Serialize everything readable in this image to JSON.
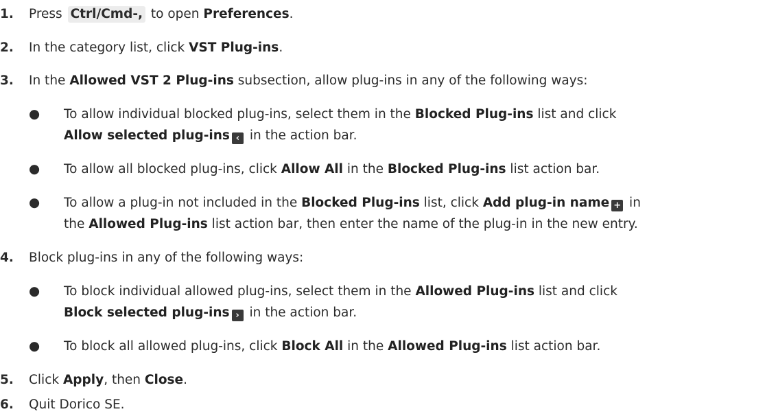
{
  "steps": [
    {
      "number": "1.",
      "parts": {
        "a": "Press ",
        "key": "Ctrl/Cmd-,",
        "b": " to open ",
        "c": "Preferences",
        "d": "."
      }
    },
    {
      "number": "2.",
      "parts": {
        "a": "In the category list, click ",
        "b": "VST Plug-ins",
        "c": "."
      }
    },
    {
      "number": "3.",
      "parts": {
        "a": "In the ",
        "b": "Allowed VST 2 Plug-ins",
        "c": " subsection, allow plug-ins in any of the following ways:"
      },
      "bullets": [
        {
          "line1": {
            "a": "To allow individual blocked plug-ins, select them in the ",
            "b": "Blocked Plug-ins",
            "c": " list and click"
          },
          "line2": {
            "a": "Allow selected plug-ins",
            "icon": "‹",
            "b": " in the action bar."
          }
        },
        {
          "line1": {
            "a": "To allow all blocked plug-ins, click ",
            "b": "Allow All",
            "c": " in the ",
            "d": "Blocked Plug-ins",
            "e": " list action bar."
          }
        },
        {
          "line1": {
            "a": "To allow a plug-in not included in the ",
            "b": "Blocked Plug-ins",
            "c": " list, click ",
            "d": "Add plug-in name",
            "icon": "+",
            "e": " in"
          },
          "line2": {
            "a": "the ",
            "b": "Allowed Plug-ins",
            "c": " list action bar, then enter the name of the plug-in in the new entry."
          }
        }
      ]
    },
    {
      "number": "4.",
      "parts": {
        "a": "Block plug-ins in any of the following ways:"
      },
      "bullets": [
        {
          "line1": {
            "a": "To block individual allowed plug-ins, select them in the ",
            "b": "Allowed Plug-ins",
            "c": " list and click"
          },
          "line2": {
            "a": "Block selected plug-ins",
            "icon": "›",
            "b": " in the action bar."
          }
        },
        {
          "line1": {
            "a": "To block all allowed plug-ins, click ",
            "b": "Block All",
            "c": " in the ",
            "d": "Allowed Plug-ins",
            "e": " list action bar."
          }
        }
      ]
    },
    {
      "number": "5.",
      "parts": {
        "a": "Click ",
        "b": "Apply",
        "c": ", then ",
        "d": "Close",
        "e": "."
      }
    },
    {
      "number": "6.",
      "parts": {
        "a": "Quit Dorico SE."
      }
    }
  ],
  "icons": {
    "allow_selected": "chevron-left-icon",
    "add_plugin_name": "plus-icon",
    "block_selected": "chevron-right-icon"
  },
  "colors": {
    "text": "#2b2b2b",
    "key_background": "#ececec",
    "icon_background": "#3a3a3a"
  }
}
